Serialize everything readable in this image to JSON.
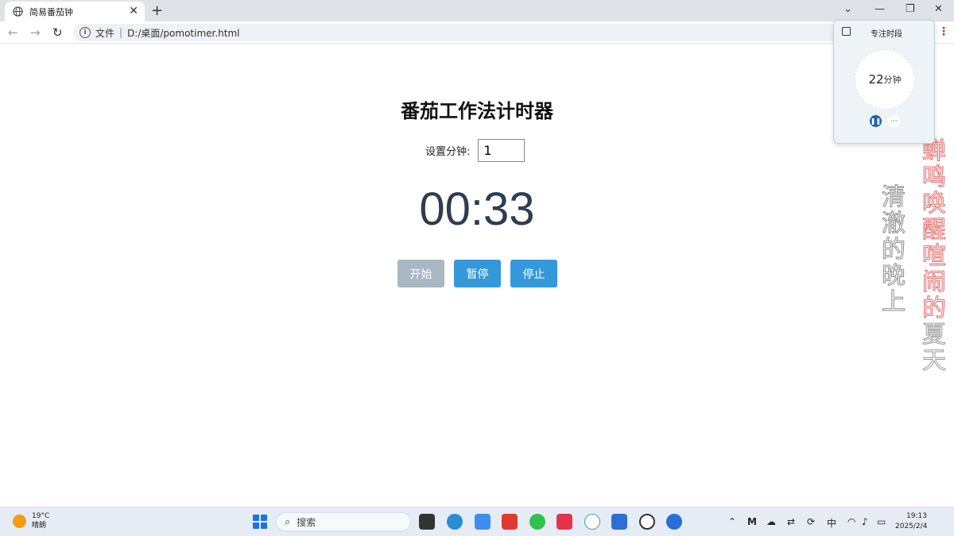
{
  "browser": {
    "tab_title": "简易番茄钟",
    "tab_close": "✕",
    "new_tab": "+",
    "url_prefix": "文件",
    "url_sep": "|",
    "url": "D:/桌面/pomotimer.html",
    "info_icon": "i"
  },
  "app": {
    "title": "番茄工作法计时器",
    "minutes_label": "设置分钟:",
    "minutes_value": "1",
    "time_display": "00:33",
    "buttons": {
      "start": "开始",
      "pause": "暂停",
      "stop": "停止"
    }
  },
  "focus_widget": {
    "title": "专注时段",
    "minutes": "22",
    "unit": "分钟"
  },
  "desktop_text": {
    "grey": [
      "清",
      "澈",
      "的",
      "晚",
      "上"
    ],
    "red": [
      "蝉",
      "鸣",
      "唤",
      "醒",
      "喧",
      "闹",
      "的",
      "夏",
      "天"
    ]
  },
  "taskbar": {
    "temp": "19°C",
    "weather": "晴朗",
    "search_placeholder": "搜索",
    "ime": "中",
    "time": "19:13",
    "date": "2025/2/4"
  }
}
